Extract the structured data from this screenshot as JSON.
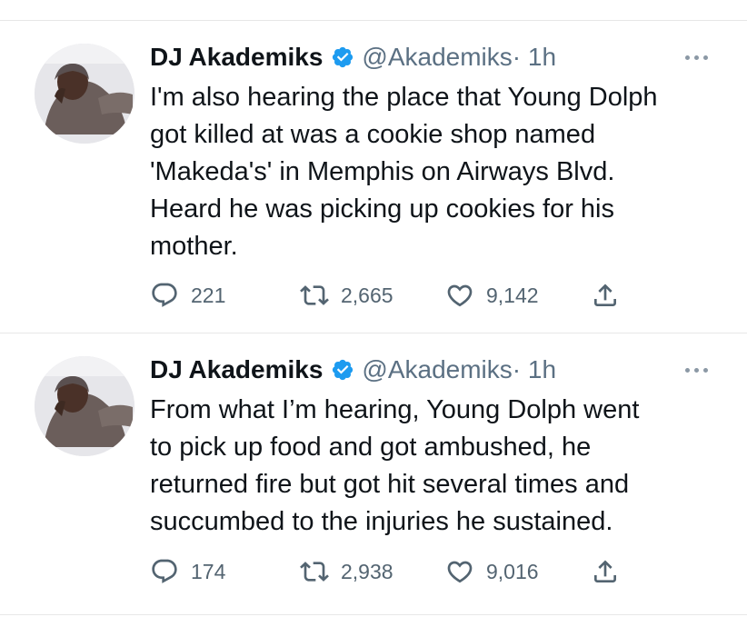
{
  "tweets": [
    {
      "author_name": "DJ Akademiks",
      "handle": "@Akademiks",
      "time": " · 1h",
      "text_lines": [
        "I'm also hearing the place that Young Dolph",
        "got killed at was a cookie shop named",
        "'Makeda's' in Memphis on Airways Blvd.",
        "Heard he was picking up cookies for his",
        "mother."
      ],
      "replies": "221",
      "retweets": "2,665",
      "likes": "9,142"
    },
    {
      "author_name": "DJ Akademiks",
      "handle": "@Akademiks",
      "time": " · 1h",
      "text_lines": [
        "From what I’m hearing, Young Dolph went",
        "to pick up food and got ambushed, he",
        "returned fire but got hit several times and",
        "succumbed to the injuries he sustained."
      ],
      "replies": "174",
      "retweets": "2,938",
      "likes": "9,016"
    }
  ],
  "colors": {
    "verified_badge": "#1d9bf0",
    "secondary_text": "#5b7083",
    "icon": "#536471",
    "divider": "#e7e7e7"
  },
  "icons": [
    "verified-badge-icon",
    "more-options-icon",
    "reply-icon",
    "retweet-icon",
    "like-icon",
    "share-icon"
  ]
}
